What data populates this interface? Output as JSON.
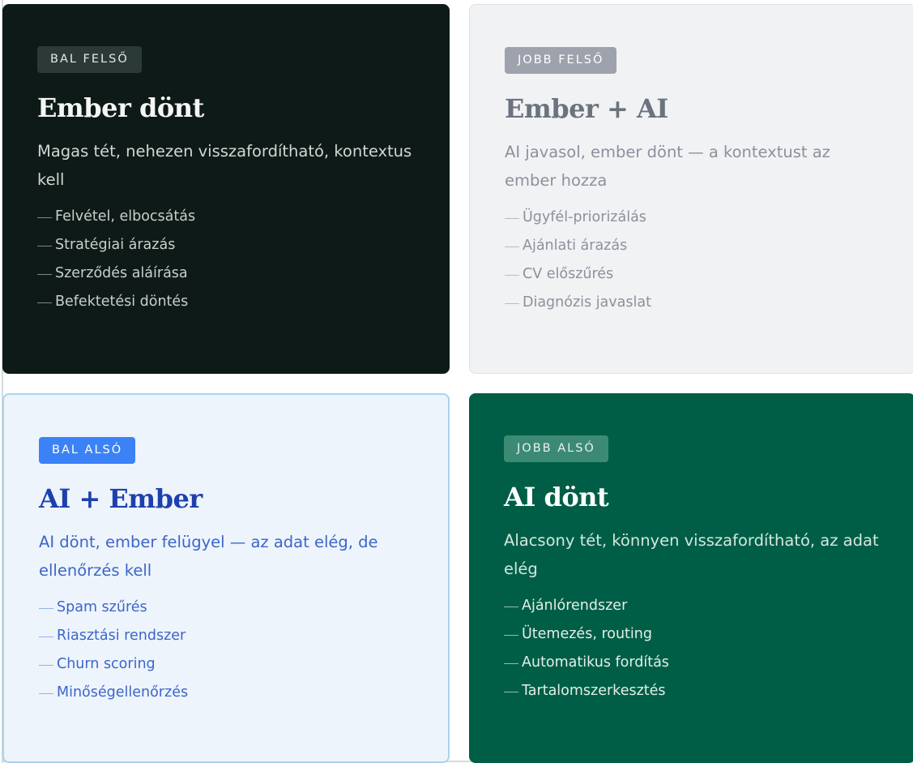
{
  "quadrants": {
    "top_left": {
      "badge": "BAL FELSŐ",
      "title": "Ember dönt",
      "subtitle": "Magas tét, nehezen visszafordítható, kontextus kell",
      "items": [
        "Felvétel, elbocsátás",
        "Stratégiai árazás",
        "Szerződés aláírása",
        "Befektetési döntés"
      ],
      "colors": {
        "background": "#0e1a17",
        "text": "#f4f6f5"
      }
    },
    "top_right": {
      "badge": "JOBB FELSŐ",
      "title": "Ember + AI",
      "subtitle": "AI javasol, ember dönt — a kontextust az ember hozza",
      "items": [
        "Ügyfél-priorizálás",
        "Ajánlati árazás",
        "CV előszűrés",
        "Diagnózis javaslat"
      ],
      "colors": {
        "background": "#f1f2f4",
        "text": "#6b7280"
      }
    },
    "bottom_left": {
      "badge": "BAL ALSÓ",
      "title": "AI + Ember",
      "subtitle": "AI dönt, ember felügyel — az adat elég, de ellenőrzés kell",
      "items": [
        "Spam szűrés",
        "Riasztási rendszer",
        "Churn scoring",
        "Minőségellenőrzés"
      ],
      "colors": {
        "background": "#eef4fc",
        "text": "#1e40af",
        "badge": "#3b82f6"
      }
    },
    "bottom_right": {
      "badge": "JOBB ALSÓ",
      "title": "AI dönt",
      "subtitle": "Alacsony tét, könnyen visszafordítható, az adat elég",
      "items": [
        "Ajánlórendszer",
        "Ütemezés, routing",
        "Automatikus fordítás",
        "Tartalomszerkesztés"
      ],
      "colors": {
        "background": "#005e46",
        "text": "#ffffff"
      }
    }
  }
}
